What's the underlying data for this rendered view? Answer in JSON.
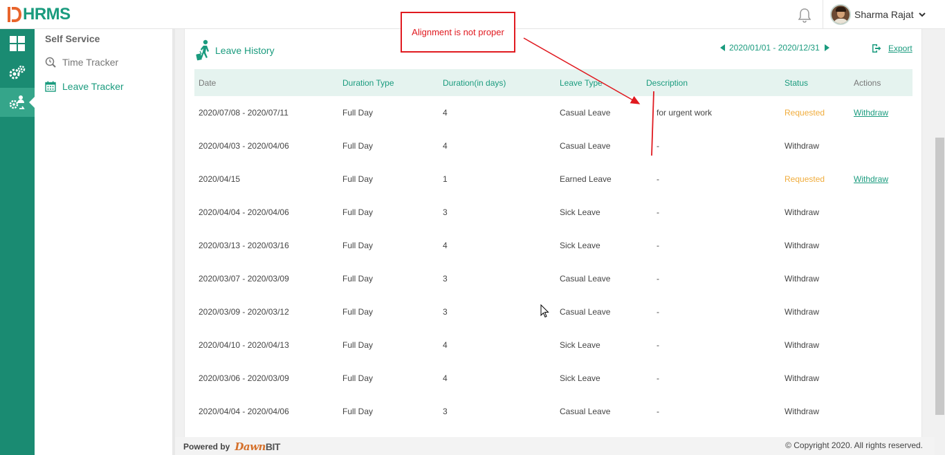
{
  "app": {
    "logo_text": "HRMS",
    "logo_letter": "D",
    "user_name": "Sharma Rajat"
  },
  "sidebar": {
    "section_title": "Self Service",
    "items": [
      {
        "label": "Time Tracker",
        "icon": "clock-search-icon",
        "active": false
      },
      {
        "label": "Leave Tracker",
        "icon": "calendar-icon",
        "active": true
      }
    ]
  },
  "rail": {
    "items": [
      "dashboard-grid-icon",
      "settings-gears-icon",
      "self-service-icon"
    ]
  },
  "page": {
    "title": "Leave History",
    "date_range": "2020/01/01 - 2020/12/31",
    "export_label": "Export"
  },
  "table": {
    "columns": [
      "Date",
      "Duration Type",
      "Duration(in days)",
      "Leave Type",
      "Description",
      "Status",
      "Actions"
    ],
    "rows": [
      {
        "date": "2020/07/08 - 2020/07/11",
        "duration_type": "Full Day",
        "days": "4",
        "leave_type": "Casual Leave",
        "description": "for urgent work",
        "status": "Requested",
        "action": "Withdraw"
      },
      {
        "date": "2020/04/03 - 2020/04/06",
        "duration_type": "Full Day",
        "days": "4",
        "leave_type": "Casual Leave",
        "description": "-",
        "status": "Withdraw",
        "action": ""
      },
      {
        "date": "2020/04/15",
        "duration_type": "Full Day",
        "days": "1",
        "leave_type": "Earned Leave",
        "description": "-",
        "status": "Requested",
        "action": "Withdraw"
      },
      {
        "date": "2020/04/04 - 2020/04/06",
        "duration_type": "Full Day",
        "days": "3",
        "leave_type": "Sick Leave",
        "description": "-",
        "status": "Withdraw",
        "action": ""
      },
      {
        "date": "2020/03/13 - 2020/03/16",
        "duration_type": "Full Day",
        "days": "4",
        "leave_type": "Sick Leave",
        "description": "-",
        "status": "Withdraw",
        "action": ""
      },
      {
        "date": "2020/03/07 - 2020/03/09",
        "duration_type": "Full Day",
        "days": "3",
        "leave_type": "Casual Leave",
        "description": "-",
        "status": "Withdraw",
        "action": ""
      },
      {
        "date": "2020/03/09 - 2020/03/12",
        "duration_type": "Full Day",
        "days": "3",
        "leave_type": "Casual Leave",
        "description": "-",
        "status": "Withdraw",
        "action": ""
      },
      {
        "date": "2020/04/10 - 2020/04/13",
        "duration_type": "Full Day",
        "days": "4",
        "leave_type": "Sick Leave",
        "description": "-",
        "status": "Withdraw",
        "action": ""
      },
      {
        "date": "2020/03/06 - 2020/03/09",
        "duration_type": "Full Day",
        "days": "4",
        "leave_type": "Sick Leave",
        "description": "-",
        "status": "Withdraw",
        "action": ""
      },
      {
        "date": "2020/04/04 - 2020/04/06",
        "duration_type": "Full Day",
        "days": "3",
        "leave_type": "Casual Leave",
        "description": "-",
        "status": "Withdraw",
        "action": ""
      }
    ]
  },
  "footer": {
    "powered_by": "Powered by",
    "brand_part1": "Dawn",
    "brand_part2": "BIT",
    "copyright": "© Copyright 2020. All rights reserved."
  },
  "annotation": {
    "text": "Alignment is not proper"
  },
  "colors": {
    "primary": "#1a9b7e",
    "rail": "#1a8b72",
    "requested": "#f0ac3c",
    "annotation": "#e0191f",
    "header_bg": "#e5f3ef"
  }
}
